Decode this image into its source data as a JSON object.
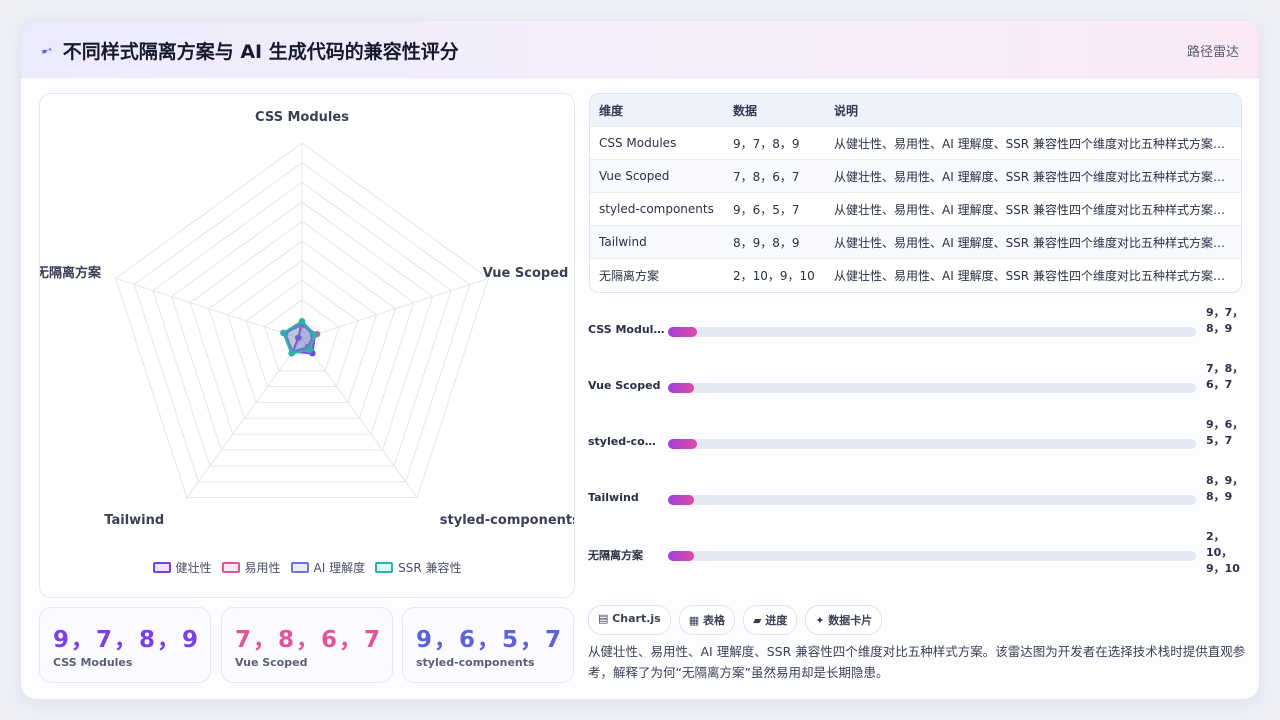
{
  "header": {
    "title": "不同样式隔离方案与 AI 生成代码的兼容性评分",
    "title_icon": "spark-icon",
    "link": "路径雷达"
  },
  "chart_data": {
    "type": "radar",
    "axes": [
      "CSS Modules",
      "Vue Scoped",
      "styled-components",
      "Tailwind",
      "无隔离方案"
    ],
    "series": [
      {
        "name": "健壮性",
        "color": "#7b3fe4",
        "values": [
          9,
          7,
          9,
          8,
          2
        ]
      },
      {
        "name": "易用性",
        "color": "#e0559a",
        "values": [
          7,
          8,
          6,
          9,
          10
        ]
      },
      {
        "name": "AI 理解度",
        "color": "#6a73e0",
        "values": [
          8,
          6,
          5,
          8,
          9
        ]
      },
      {
        "name": "SSR 兼容性",
        "color": "#2bb3a8",
        "values": [
          9,
          7,
          7,
          9,
          10
        ]
      }
    ],
    "rings": 10,
    "display_max": 100
  },
  "stats": [
    {
      "value": "9，7，8，9",
      "label": "CSS Modules",
      "color": "#7b3fe4"
    },
    {
      "value": "7，8，6，7",
      "label": "Vue Scoped",
      "color": "#e0559a"
    },
    {
      "value": "9，6，5，7",
      "label": "styled-components",
      "color": "#5b63d6"
    }
  ],
  "table": {
    "headers": [
      "维度",
      "数据",
      "说明"
    ],
    "rows": [
      [
        "CSS Modules",
        "9，7，8，9",
        "从健壮性、易用性、AI 理解度、SSR 兼容性四个维度对比五种样式方案。该雷达图为开发者"
      ],
      [
        "Vue Scoped",
        "7，8，6，7",
        "从健壮性、易用性、AI 理解度、SSR 兼容性四个维度对比五种样式方案。该雷达图为开发者"
      ],
      [
        "styled-components",
        "9，6，5，7",
        "从健壮性、易用性、AI 理解度、SSR 兼容性四个维度对比五种样式方案。该雷达图为开发者"
      ],
      [
        "Tailwind",
        "8，9，8，9",
        "从健壮性、易用性、AI 理解度、SSR 兼容性四个维度对比五种样式方案。该雷达图为开发者"
      ],
      [
        "无隔离方案",
        "2，10，9，10",
        "从健壮性、易用性、AI 理解度、SSR 兼容性四个维度对比五种样式方案。该雷达图为开发者"
      ]
    ]
  },
  "bars": [
    {
      "label": "CSS Modules",
      "value_text": "9，7，8，9",
      "fraction": 0.055
    },
    {
      "label": "Vue Scoped",
      "value_text": "7，8，6，7",
      "fraction": 0.05
    },
    {
      "label": "styled-components",
      "value_text": "9，6，5，7",
      "fraction": 0.055
    },
    {
      "label": "Tailwind",
      "value_text": "8，9，8，9",
      "fraction": 0.05
    },
    {
      "label": "无隔离方案",
      "value_text": "2，10，9，10",
      "fraction": 0.05
    }
  ],
  "chips": [
    "▤ Chart.js",
    "▦ 表格",
    "▰ 进度",
    "✦ 数据卡片"
  ],
  "description": "从健壮性、易用性、AI 理解度、SSR 兼容性四个维度对比五种样式方案。该雷达图为开发者在选择技术栈时提供直观参考，解释了为何“无隔离方案”虽然易用却是长期隐患。"
}
